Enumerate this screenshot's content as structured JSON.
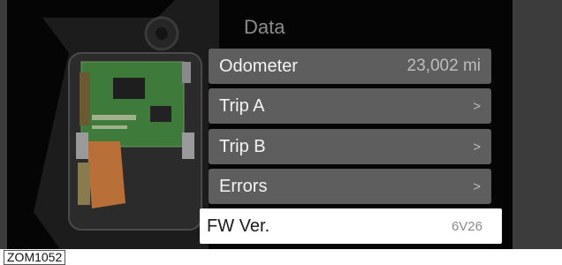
{
  "screen": {
    "title": "Data",
    "menu": [
      {
        "label": "Odometer",
        "value": "23,002 mi",
        "chevron": ""
      },
      {
        "label": "Trip A",
        "value": "",
        "chevron": ">"
      },
      {
        "label": "Trip B",
        "value": "",
        "chevron": ">"
      },
      {
        "label": "Errors",
        "value": "",
        "chevron": ">"
      },
      {
        "label": "FW Ver.",
        "value": "6V26",
        "chevron": ""
      }
    ],
    "selected_item": "FW Ver."
  },
  "figure": {
    "reference_code": "ZOM1052"
  },
  "colors": {
    "background": "#050505",
    "menu_item": "#5e5e5e",
    "menu_selected": "#ffffff",
    "title": "#8c8c8c",
    "circuit_board": "#3e7a3a",
    "ribbon_cable": "#b86f38"
  },
  "icons": {
    "chevron": "chevron-right-icon"
  }
}
